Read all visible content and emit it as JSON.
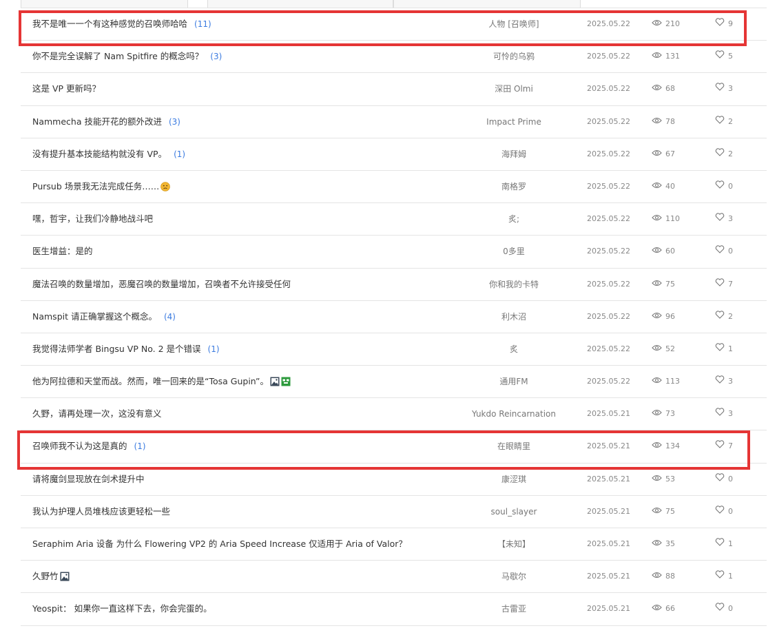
{
  "posts": [
    {
      "title": "我不是唯一一个有这种感觉的召唤师哈哈",
      "comments": "(11)",
      "author": "人物 [召唤师]",
      "date": "2025.05.22",
      "views": "210",
      "likes": "9",
      "emoji": []
    },
    {
      "title": "你不是完全误解了 Nam Spitfire 的概念吗？",
      "comments": "(3)",
      "author": "可怜的乌鸦",
      "date": "2025.05.22",
      "views": "131",
      "likes": "5",
      "emoji": []
    },
    {
      "title": "这是 VP 更新吗？",
      "comments": "",
      "author": "深田 Olmi",
      "date": "2025.05.22",
      "views": "68",
      "likes": "3",
      "emoji": []
    },
    {
      "title": "Nammecha 技能开花的额外改进",
      "comments": "(3)",
      "author": "Impact Prime",
      "date": "2025.05.22",
      "views": "78",
      "likes": "2",
      "emoji": []
    },
    {
      "title": "没有提升基本技能结构就没有 VP。",
      "comments": "(1)",
      "author": "海拜姆",
      "date": "2025.05.22",
      "views": "67",
      "likes": "2",
      "emoji": []
    },
    {
      "title": "Pursub 场景我无法完成任务……",
      "comments": "",
      "author": "南格罗",
      "date": "2025.05.22",
      "views": "40",
      "likes": "0",
      "emoji": [
        "sad-face"
      ]
    },
    {
      "title": "嘿，哲宇，让我们冷静地战斗吧",
      "comments": "",
      "author": "炙;",
      "date": "2025.05.22",
      "views": "110",
      "likes": "3",
      "emoji": []
    },
    {
      "title": "医生增益：是的",
      "comments": "",
      "author": "0多里",
      "date": "2025.05.22",
      "views": "60",
      "likes": "0",
      "emoji": []
    },
    {
      "title": "魔法召唤的数量增加，恶魔召唤的数量增加，召唤者不允许接受任何",
      "comments": "",
      "author": "你和我的卡特",
      "date": "2025.05.22",
      "views": "75",
      "likes": "7",
      "emoji": []
    },
    {
      "title": "Namspit 请正确掌握这个概念。",
      "comments": "(4)",
      "author": "利木沼",
      "date": "2025.05.22",
      "views": "96",
      "likes": "2",
      "emoji": []
    },
    {
      "title": "我觉得法师学者 Bingsu VP No. 2 是个错误",
      "comments": "(1)",
      "author": "炙",
      "date": "2025.05.22",
      "views": "52",
      "likes": "1",
      "emoji": []
    },
    {
      "title": "他为阿拉德和天堂而战。然而，唯一回来的是“Tosa Gupin”。",
      "comments": "",
      "author": "通用FM",
      "date": "2025.05.22",
      "views": "113",
      "likes": "3",
      "emoji": [
        "image",
        "image-green"
      ]
    },
    {
      "title": "久野，请再处理一次，这没有意义",
      "comments": "",
      "author": "Yukdo Reincarnation",
      "date": "2025.05.21",
      "views": "73",
      "likes": "3",
      "emoji": []
    },
    {
      "title": "召唤师我不认为这是真的",
      "comments": "(1)",
      "author": "在眼睛里",
      "date": "2025.05.21",
      "views": "134",
      "likes": "7",
      "emoji": []
    },
    {
      "title": "请将魔剑显现放在剑术提升中",
      "comments": "",
      "author": "康涩琪",
      "date": "2025.05.21",
      "views": "53",
      "likes": "0",
      "emoji": []
    },
    {
      "title": "我认为护理人员堆栈应该更轻松一些",
      "comments": "",
      "author": "soul_slayer",
      "date": "2025.05.21",
      "views": "75",
      "likes": "0",
      "emoji": []
    },
    {
      "title": "Seraphim Aria 设备 为什么 Flowering VP2 的 Aria Speed Increase 仅适用于 Aria of Valor？",
      "comments": "",
      "author": "【未知】",
      "date": "2025.05.21",
      "views": "35",
      "likes": "1",
      "emoji": []
    },
    {
      "title": "久野竹",
      "comments": "",
      "author": "马歇尔",
      "date": "2025.05.21",
      "views": "88",
      "likes": "1",
      "emoji": [
        "image"
      ]
    },
    {
      "title": "Yeospit： 如果你一直这样下去，你会完蛋的。",
      "comments": "",
      "author": "古雷亚",
      "date": "2025.05.21",
      "views": "66",
      "likes": "0",
      "emoji": []
    }
  ],
  "colors": {
    "highlight": "#e53535",
    "comment_count": "#3b7be0"
  }
}
